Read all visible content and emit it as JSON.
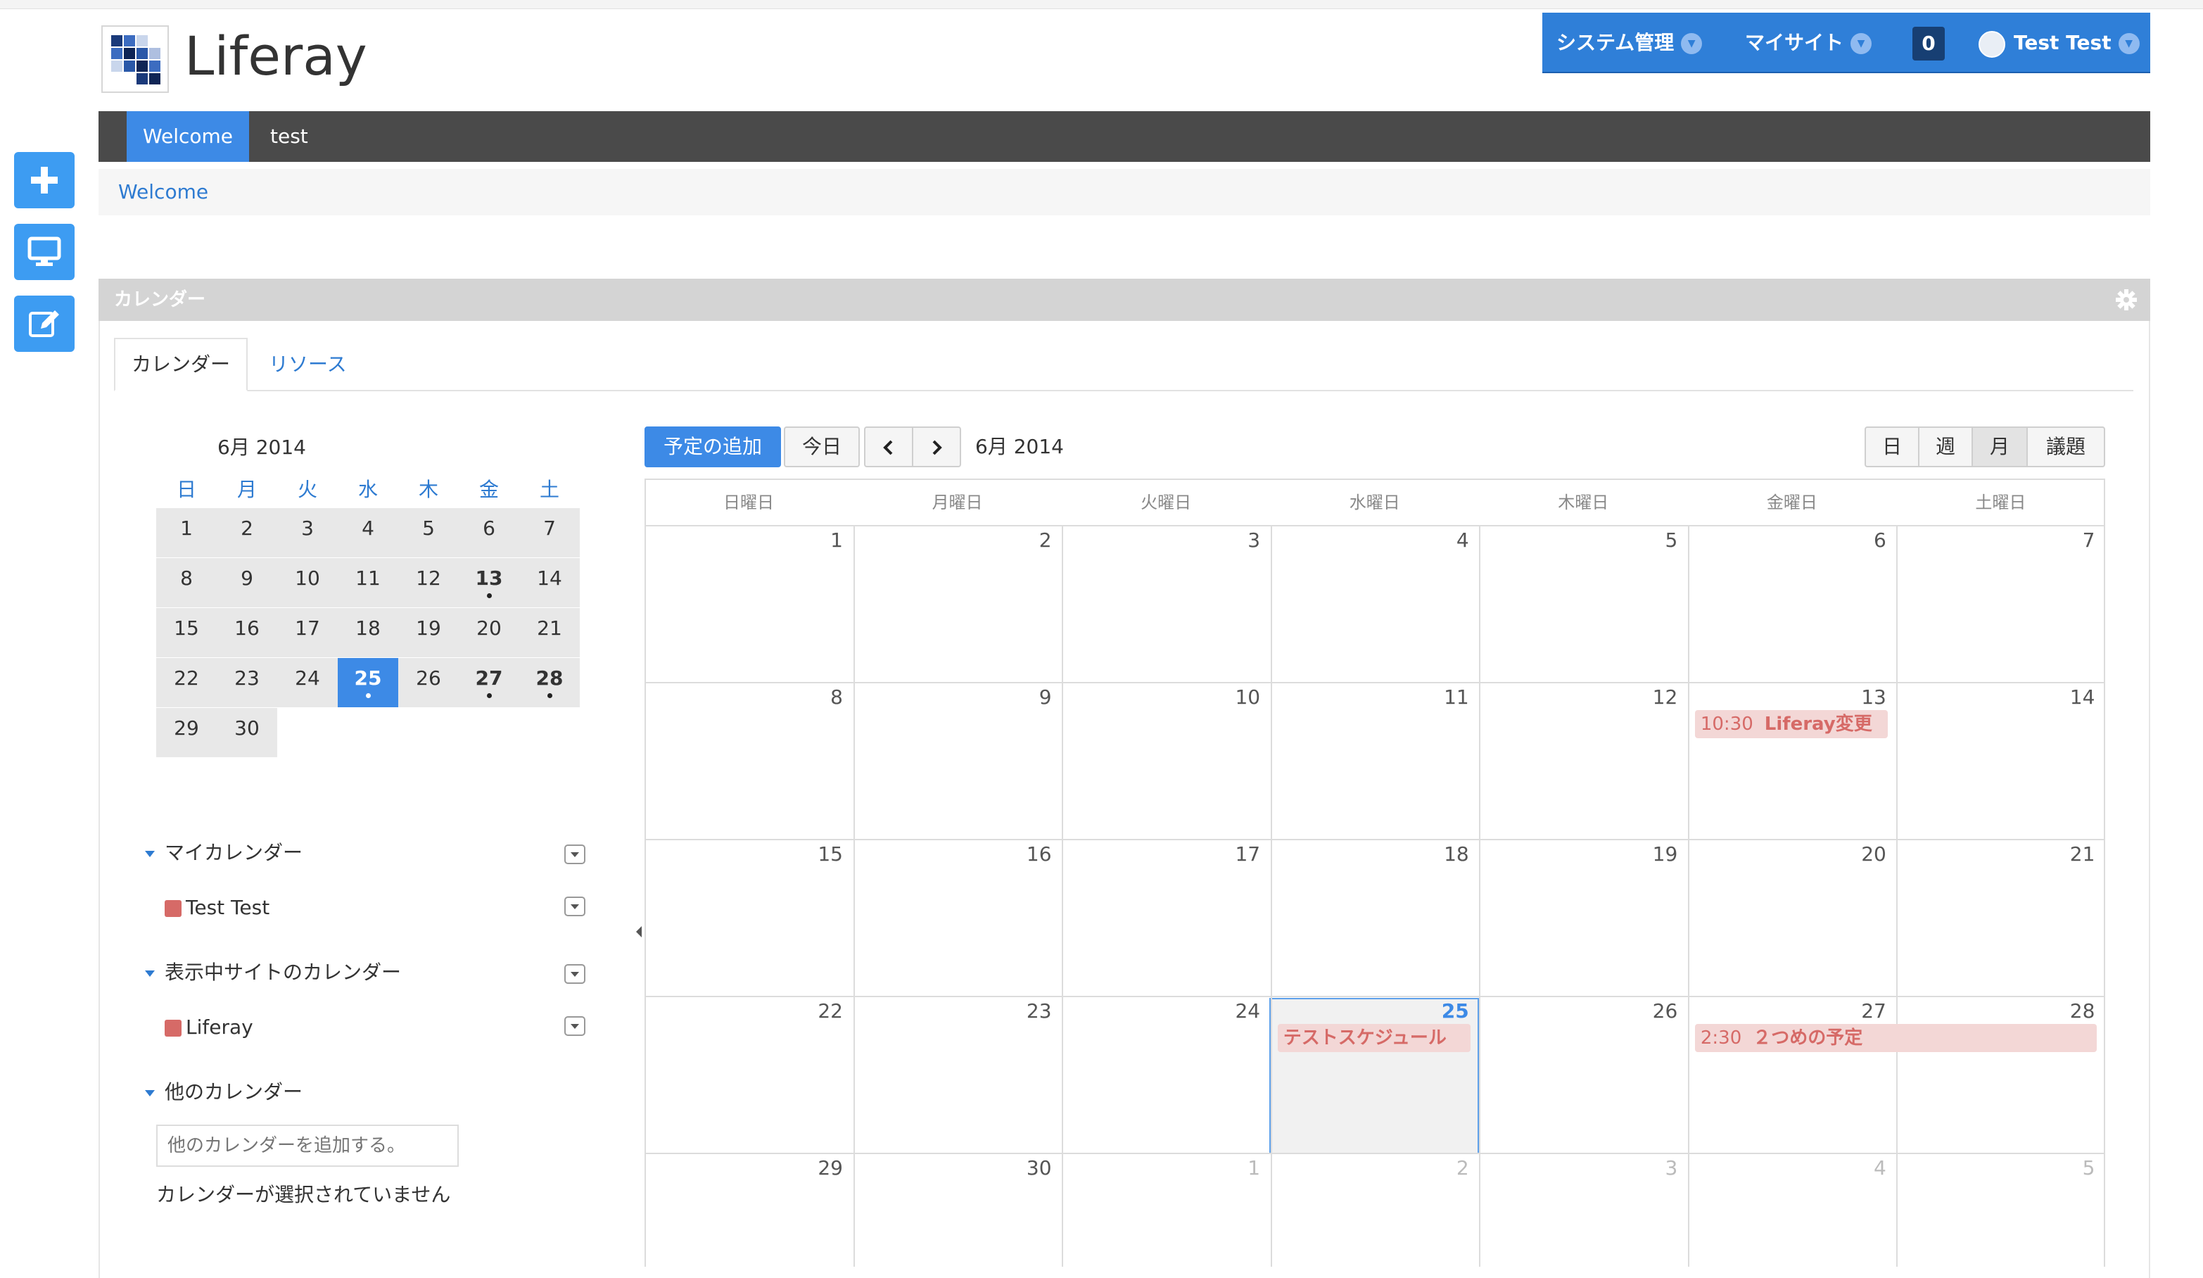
{
  "site": {
    "name": "Liferay"
  },
  "dockbar": {
    "admin": "システム管理",
    "my_sites": "マイサイト",
    "notifications": "0",
    "user": "Test Test"
  },
  "nav": {
    "welcome": "Welcome",
    "test": "test"
  },
  "breadcrumb": "Welcome",
  "portlet": {
    "title": "カレンダー"
  },
  "tabs": {
    "calendar": "カレンダー",
    "resources": "リソース"
  },
  "mini_calendar": {
    "title": "6月 2014",
    "weekdays": [
      "日",
      "月",
      "火",
      "水",
      "木",
      "金",
      "土"
    ],
    "days": [
      "1",
      "2",
      "3",
      "4",
      "5",
      "6",
      "7",
      "8",
      "9",
      "10",
      "11",
      "12",
      "13",
      "14",
      "15",
      "16",
      "17",
      "18",
      "19",
      "20",
      "21",
      "22",
      "23",
      "24",
      "25",
      "26",
      "27",
      "28",
      "29",
      "30"
    ],
    "event_days": [
      "13",
      "25",
      "27",
      "28"
    ],
    "today": "25"
  },
  "calendars": {
    "my_section": "マイカレンダー",
    "my_items": [
      {
        "name": "Test Test",
        "color": "#d66a67"
      }
    ],
    "site_section": "表示中サイトのカレンダー",
    "site_items": [
      {
        "name": "Liferay",
        "color": "#d66a67"
      }
    ],
    "other_section": "他のカレンダー",
    "other_placeholder": "他のカレンダーを追加する。",
    "none_selected": "カレンダーが選択されていません"
  },
  "toolbar": {
    "add_event": "予定の追加",
    "today": "今日",
    "prev": "‹",
    "next": "›",
    "current_month": "6月 2014",
    "views": {
      "day": "日",
      "week": "週",
      "month": "月",
      "agenda": "議題"
    },
    "active_view": "月"
  },
  "month_view": {
    "weekday_headers": [
      "日曜日",
      "月曜日",
      "火曜日",
      "水曜日",
      "木曜日",
      "金曜日",
      "土曜日"
    ],
    "weeks": [
      [
        "1",
        "2",
        "3",
        "4",
        "5",
        "6",
        "7"
      ],
      [
        "8",
        "9",
        "10",
        "11",
        "12",
        "13",
        "14"
      ],
      [
        "15",
        "16",
        "17",
        "18",
        "19",
        "20",
        "21"
      ],
      [
        "22",
        "23",
        "24",
        "25",
        "26",
        "27",
        "28"
      ],
      [
        "29",
        "30",
        "1",
        "2",
        "3",
        "4",
        "5"
      ]
    ],
    "today": "25",
    "events": [
      {
        "time": "10:30",
        "title": "Liferay変更",
        "date": "2014-06-13"
      },
      {
        "time": "",
        "title": "テストスケジュール",
        "date": "2014-06-25"
      },
      {
        "time": "2:30",
        "title": "２つめの予定",
        "date": "2014-06-27 – 2014-06-28"
      }
    ]
  },
  "colors": {
    "accent": "#3d8ae6",
    "event_bg": "#f3d7d6",
    "event_text": "#d66a67",
    "nav_bg": "#4a4a4a"
  }
}
